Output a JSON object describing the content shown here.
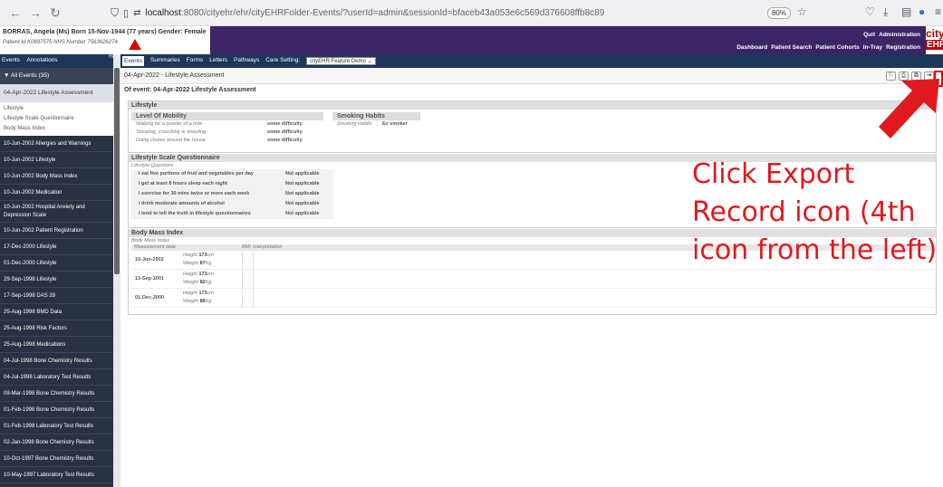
{
  "browser": {
    "url_prefix": "localhost",
    "url_rest": ":8080/cityehr/ehr/cityEHRFolder-Events/?userId=admin&sessionId=bfaceb43a053e6c569d376608ffb8c89",
    "zoom": "80%"
  },
  "patient": {
    "line1": "BORRAS, Angela (Ms) Born 15-Nov-1944 (77 years) Gender: Female",
    "line2": "Patient Id K0897575   NHS Number 7563626274"
  },
  "topnav": {
    "row1": [
      "Quit",
      "Administration"
    ],
    "row2": [
      "Dashboard",
      "Patient Search",
      "Patient Cohorts",
      "In-Tray",
      "Registration"
    ]
  },
  "logo": {
    "top": "city",
    "bottom": "EHR"
  },
  "lefttabs": [
    "Events",
    "Annotations"
  ],
  "hide": "Hide",
  "midtabs": [
    "Events",
    "Summaries",
    "Forms",
    "Letters",
    "Pathways"
  ],
  "care_setting_label": "Care Setting:",
  "care_setting_value": "cityEHR Feature Demo",
  "sidebar": {
    "all_events": "▼ All Events (35)",
    "selected": "04-Apr-2022 Lifestyle Assessment",
    "subitems": [
      "Lifestyle",
      "Lifestyle Scale Questionnaire",
      "Body Mass Index"
    ],
    "events": [
      "10-Jun-2002 Allergies and Warnings",
      "10-Jun-2002 Lifestyle",
      "10-Jun-2002 Body Mass Index",
      "10-Jun-2002 Medication",
      "10-Jun-2002 Hospital Anxiety and Depression Scale",
      "10-Jun-2002 Patient Registration",
      "17-Dec-2000 Lifestyle",
      "01-Dec-2000 Lifestyle",
      "29-Sep-1998 Lifestyle",
      "17-Sep-1998 DAS 28",
      "25-Aug-1998 BMD Data",
      "25-Aug-1998 Risk Factors",
      "25-Aug-1998 Medications",
      "04-Jul-1998 Bone Chemistry Results",
      "04-Jul-1998 Laboratory Test Results",
      "09-Mar-1998 Bone Chemistry Results",
      "01-Feb-1998 Bone Chemistry Results",
      "01-Feb-1998 Laboratory Test Results",
      "02-Jan-1998 Bone Chemistry Results",
      "10-Oct-1997 Bone Chemistry Results",
      "10-May-1997 Laboratory Test Results"
    ]
  },
  "main": {
    "title": "04-Apr-2022 - Lifestyle Assessment",
    "of_event": "Of event: 04-Apr-2022 Lifestyle Assessment",
    "lifestyle": {
      "heading": "Lifestyle",
      "mobility_head": "Level Of Mobility",
      "mobility": [
        {
          "q": "Walking for a quarter of a mile",
          "a": "some difficulty"
        },
        {
          "q": "Stooping, crouching or kneeling",
          "a": "some difficulty"
        },
        {
          "q": "Doing chores around the house",
          "a": "some difficulty"
        }
      ],
      "smoking_head": "Smoking Habits",
      "smoking_q": "Smoking Habits",
      "smoking_a": "Ex smoker"
    },
    "questionnaire": {
      "heading": "Lifestyle Scale Questionnaire",
      "sub": "Lifestyle Questions",
      "rows": [
        {
          "q": "I eat five portions of fruit and vegetables per day",
          "a": "Not applicable"
        },
        {
          "q": "I get at least 8 hours sleep each night",
          "a": "Not applicable"
        },
        {
          "q": "I exercise for 30 mins twice or more each week",
          "a": "Not applicable"
        },
        {
          "q": "I drink moderate amounts of alcohol",
          "a": "Not applicable"
        },
        {
          "q": "I tend to tell the truth in lifestyle questionnaires",
          "a": "Not applicable"
        }
      ]
    },
    "bmi": {
      "heading": "Body Mass Index",
      "sub": "Body Mass Index",
      "col_date": "Measurement date",
      "col_bmi": "BMI",
      "col_interp": "Interpretation",
      "h_label": "Height",
      "w_label": "Weight",
      "rows": [
        {
          "date": "10-Jun-2002",
          "h": "173",
          "hu": "cm",
          "w": "87",
          "wu": "Kg"
        },
        {
          "date": "13-Sep-2001",
          "h": "173",
          "hu": "cm",
          "w": "82",
          "wu": "Kg"
        },
        {
          "date": "01-Dec-2000",
          "h": "173",
          "hu": "cm",
          "w": "86",
          "wu": "Kg"
        }
      ]
    }
  },
  "annotation": "Click Export Record icon (4th icon from the left)",
  "colors": {
    "accent": "#e0191f",
    "nav": "#1d3659",
    "header": "#3b2566"
  }
}
